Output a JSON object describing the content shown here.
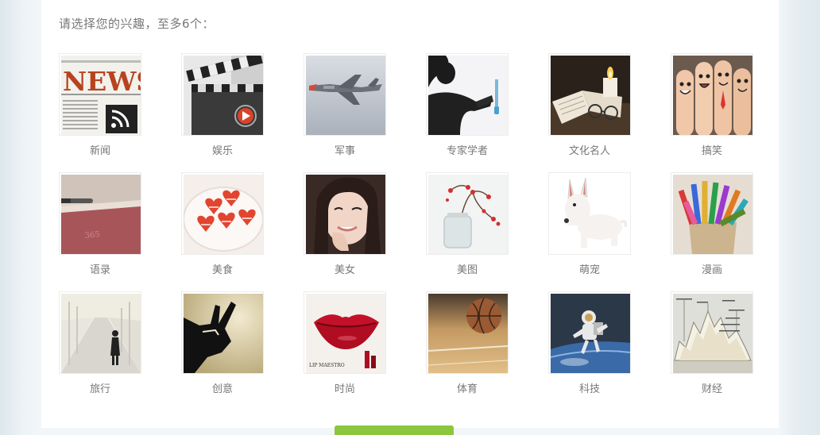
{
  "prompt": "请选择您的兴趣，至多6个：",
  "interests": [
    {
      "label": "新闻",
      "icon": "news-icon"
    },
    {
      "label": "娱乐",
      "icon": "clapperboard-icon"
    },
    {
      "label": "军事",
      "icon": "fighter-jet-icon"
    },
    {
      "label": "专家学者",
      "icon": "scientist-icon"
    },
    {
      "label": "文化名人",
      "icon": "book-candle-icon"
    },
    {
      "label": "搞笑",
      "icon": "finger-faces-icon"
    },
    {
      "label": "语录",
      "icon": "notebook-icon"
    },
    {
      "label": "美食",
      "icon": "macarons-icon"
    },
    {
      "label": "美女",
      "icon": "smiling-girl-icon"
    },
    {
      "label": "美图",
      "icon": "flower-jar-icon"
    },
    {
      "label": "萌宠",
      "icon": "bull-terrier-icon"
    },
    {
      "label": "漫画",
      "icon": "crayons-icon"
    },
    {
      "label": "旅行",
      "icon": "traveler-road-icon"
    },
    {
      "label": "创意",
      "icon": "hand-shadow-icon"
    },
    {
      "label": "时尚",
      "icon": "red-lips-icon"
    },
    {
      "label": "体育",
      "icon": "basketball-icon"
    },
    {
      "label": "科技",
      "icon": "astronaut-icon"
    },
    {
      "label": "财经",
      "icon": "finance-chart-icon"
    }
  ],
  "thumb_text": {
    "news_headline": "NEWS",
    "lips_brand": "LIP MAESTRO",
    "notebook_number": "365"
  },
  "colors": {
    "accent_green": "#8cc63f",
    "label_gray": "#777777"
  }
}
